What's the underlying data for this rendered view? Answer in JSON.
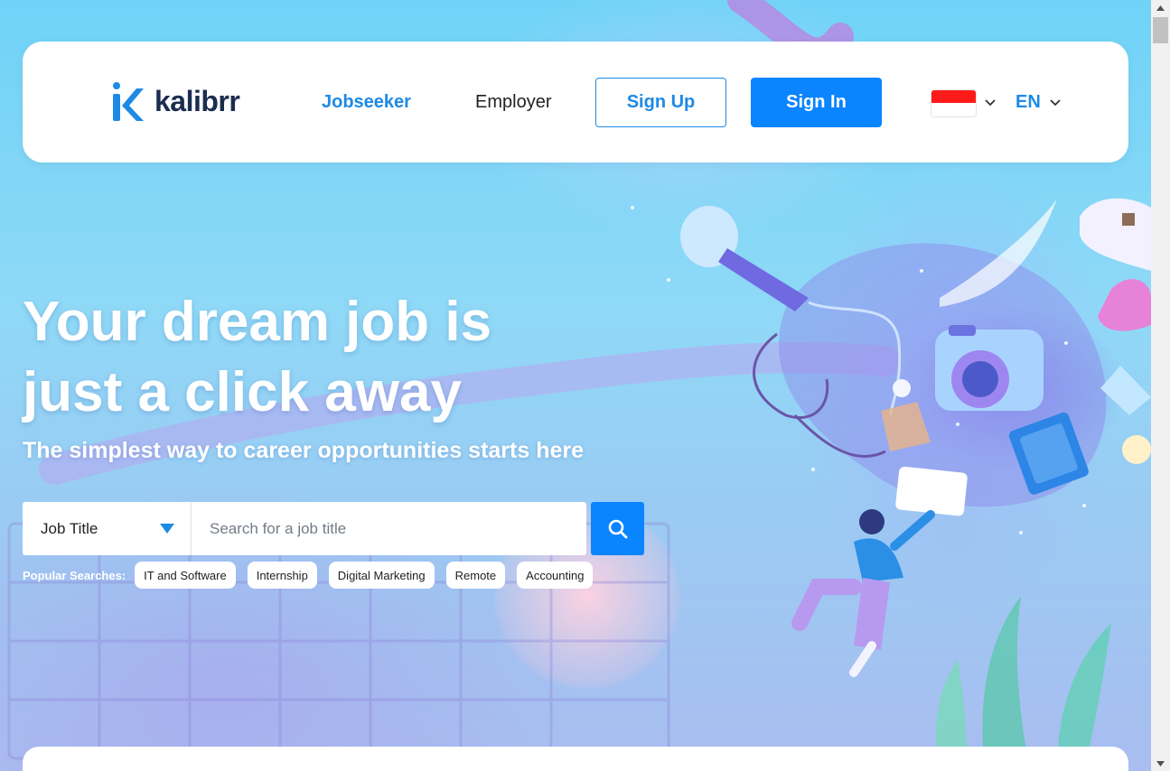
{
  "brand": {
    "name": "kalibrr",
    "color": "#1d8ae5"
  },
  "nav": {
    "jobseeker_label": "Jobseeker",
    "employer_label": "Employer",
    "signup_label": "Sign Up",
    "signin_label": "Sign In",
    "country_flag": "indonesia-flag",
    "language_label": "EN"
  },
  "hero": {
    "title_line1": "Your dream job is",
    "title_line2": "just a click away",
    "subtitle": "The simplest way to career opportunities starts here"
  },
  "search": {
    "type_label": "Job Title",
    "placeholder": "Search for a job title",
    "value": "",
    "button_icon": "search-icon",
    "accent": "#0a84ff"
  },
  "popular": {
    "label": "Popular Searches:",
    "items": [
      "IT and Software",
      "Internship",
      "Digital Marketing",
      "Remote",
      "Accounting"
    ]
  }
}
